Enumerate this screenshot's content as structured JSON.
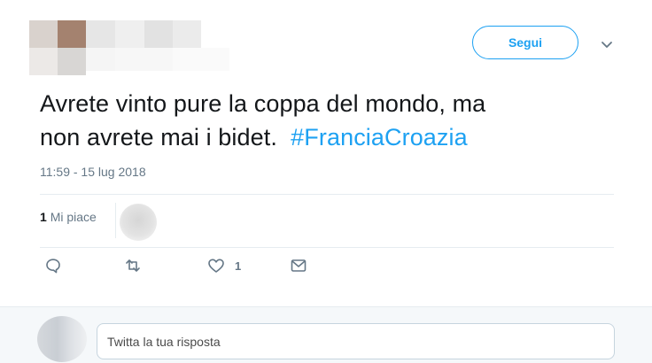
{
  "header": {
    "follow_label": "Segui"
  },
  "tweet": {
    "text_line1": "Avrete vinto pure la coppa del mondo, ma",
    "text_line2": "non avrete mai i bidet.",
    "hashtag": "#FranciaCroazia",
    "timestamp": "11:59 - 15 lug 2018"
  },
  "stats": {
    "likes_count": "1",
    "likes_label": "Mi piace"
  },
  "actions": {
    "reply_icon": "reply-icon",
    "retweet_icon": "retweet-icon",
    "like_icon": "heart-icon",
    "like_count": "1",
    "dm_icon": "envelope-icon"
  },
  "reply": {
    "placeholder": "Twitta la tua risposta"
  },
  "colors": {
    "accent": "#1da1f2",
    "muted_text": "#657786",
    "text": "#14171a",
    "divider": "#e6ecf0",
    "reply_bg": "#f5f8fa"
  }
}
